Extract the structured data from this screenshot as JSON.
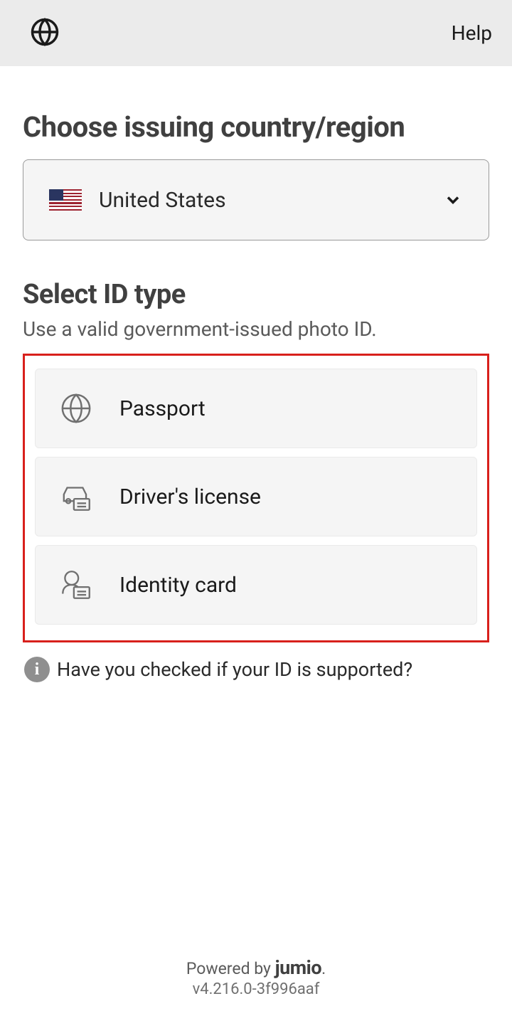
{
  "header": {
    "help_label": "Help"
  },
  "country": {
    "title": "Choose issuing country/region",
    "selected": "United States"
  },
  "id": {
    "title": "Select ID type",
    "subtitle": "Use a valid government-issued photo ID.",
    "options": [
      {
        "label": "Passport"
      },
      {
        "label": "Driver's license"
      },
      {
        "label": "Identity card"
      }
    ]
  },
  "info": {
    "text": "Have you checked if your ID is supported?"
  },
  "footer": {
    "powered_prefix": "Powered by ",
    "brand": "jumio",
    "version": "v4.216.0-3f996aaf"
  }
}
